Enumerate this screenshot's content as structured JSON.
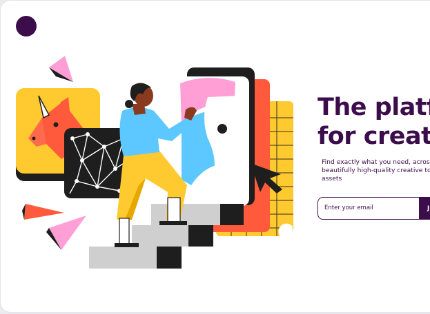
{
  "hero": {
    "headline_line1": "The platfo",
    "headline_line2": "for creativ",
    "subtext": "Find exactly what you need, across t of beautifully high-quality creative to assets"
  },
  "signup": {
    "email_placeholder": "Enter your email",
    "button_label": "J"
  },
  "colors": {
    "brand": "#3b0d4a",
    "yellow": "#ffc930",
    "red": "#ff5a3c",
    "pink": "#ff9fd6",
    "blue": "#5cc8ff",
    "gray": "#cfcfcf"
  },
  "icons": [
    "brand-logo-dot",
    "unicorn-icon",
    "cursor-arrow-icon"
  ]
}
